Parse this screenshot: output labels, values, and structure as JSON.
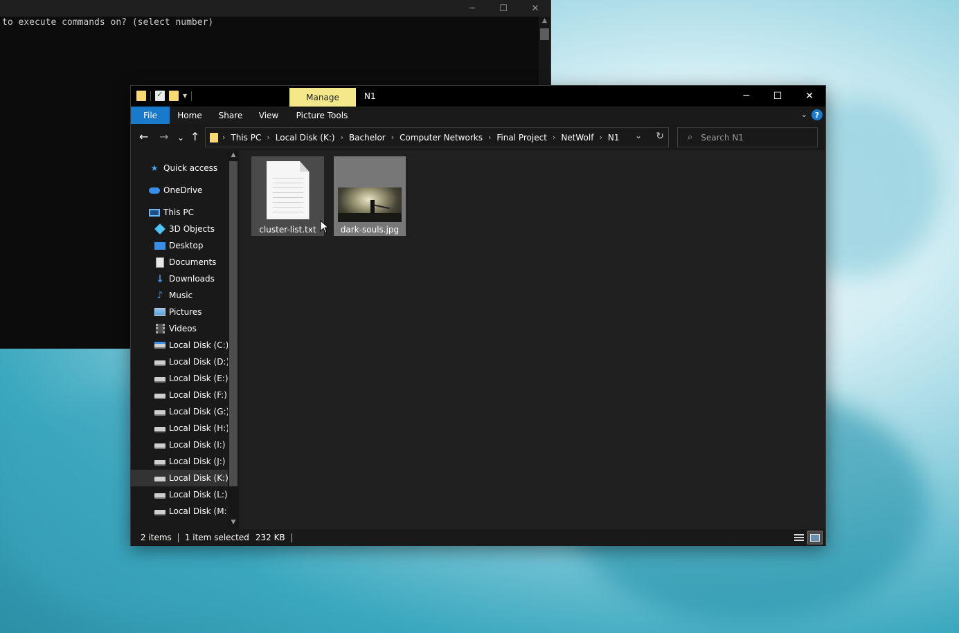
{
  "terminal": {
    "output_line": "to execute commands on? (select number)",
    "controls": {
      "minimize": "─",
      "maximize": "☐",
      "close": "✕"
    }
  },
  "explorer": {
    "title": "N1",
    "manage_tab": "Manage",
    "controls": {
      "minimize": "─",
      "maximize": "☐",
      "close": "✕"
    },
    "ribbon": {
      "tabs": [
        "File",
        "Home",
        "Share",
        "View",
        "Picture Tools"
      ],
      "help": "?"
    },
    "nav": {
      "back": "←",
      "forward": "→",
      "recent": "⌄",
      "up": "↑"
    },
    "address": {
      "crumbs": [
        "This PC",
        "Local Disk (K:)",
        "Bachelor",
        "Computer Networks",
        "Final Project",
        "NetWolf",
        "N1"
      ]
    },
    "search": {
      "placeholder": "Search N1"
    },
    "sidebar": {
      "items": [
        {
          "label": "Quick access",
          "icon": "star-icon"
        },
        {
          "label": "OneDrive",
          "icon": "cloud-icon"
        },
        {
          "label": "This PC",
          "icon": "computer-icon"
        },
        {
          "label": "3D Objects",
          "icon": "cube-icon"
        },
        {
          "label": "Desktop",
          "icon": "desktop-icon"
        },
        {
          "label": "Documents",
          "icon": "document-icon"
        },
        {
          "label": "Downloads",
          "icon": "download-icon"
        },
        {
          "label": "Music",
          "icon": "music-icon"
        },
        {
          "label": "Pictures",
          "icon": "pictures-icon"
        },
        {
          "label": "Videos",
          "icon": "video-icon"
        },
        {
          "label": "Local Disk (C:)",
          "icon": "system-disk-icon"
        },
        {
          "label": "Local Disk (D:)",
          "icon": "disk-icon"
        },
        {
          "label": "Local Disk (E:)",
          "icon": "disk-icon"
        },
        {
          "label": "Local Disk (F:)",
          "icon": "disk-icon"
        },
        {
          "label": "Local Disk (G:)",
          "icon": "disk-icon"
        },
        {
          "label": "Local Disk (H:)",
          "icon": "disk-icon"
        },
        {
          "label": "Local Disk (I:)",
          "icon": "disk-icon"
        },
        {
          "label": "Local Disk (J:)",
          "icon": "disk-icon"
        },
        {
          "label": "Local Disk (K:)",
          "icon": "disk-icon"
        },
        {
          "label": "Local Disk (L:)",
          "icon": "disk-icon"
        },
        {
          "label": "Local Disk (M:)",
          "icon": "disk-icon"
        }
      ],
      "selected": "Local Disk (K:)"
    },
    "files": [
      {
        "name": "cluster-list.txt",
        "type": "text",
        "state": "hover"
      },
      {
        "name": "dark-souls.jpg",
        "type": "image",
        "state": "selected"
      }
    ],
    "status": {
      "item_count": "2 items",
      "selection": "1 item selected",
      "size": "232 KB"
    },
    "colors": {
      "accent": "#1979ca",
      "manage_tab": "#f3e98a",
      "folder": "#f8d775"
    }
  }
}
